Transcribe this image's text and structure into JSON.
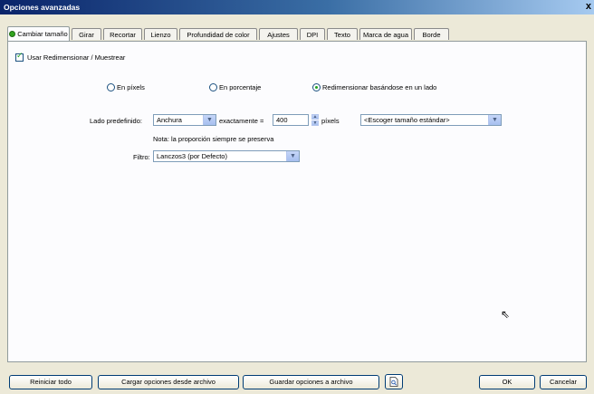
{
  "window": {
    "title": "Opciones avanzadas",
    "close_label": "x"
  },
  "tabs": [
    {
      "label": "Cambiar tamaño",
      "active": true
    },
    {
      "label": "Girar"
    },
    {
      "label": "Recortar"
    },
    {
      "label": "Lienzo"
    },
    {
      "label": "Profundidad de color"
    },
    {
      "label": "Ajustes"
    },
    {
      "label": "DPI"
    },
    {
      "label": "Texto"
    },
    {
      "label": "Marca de agua"
    },
    {
      "label": "Borde"
    }
  ],
  "resize": {
    "use_resample_label": "Usar Redimensionar / Muestrear",
    "use_resample_checked": true,
    "radios": [
      {
        "label": "En píxels",
        "selected": false
      },
      {
        "label": "En porcentaje",
        "selected": false
      },
      {
        "label": "Redimensionar basándose en un lado",
        "selected": true
      }
    ],
    "side_label": "Lado predefinido:",
    "side_value": "Anchura",
    "exact_label": "exactamente =",
    "exact_value": "400",
    "pixels_label": "píxels",
    "standard_size_value": "<Escoger tamaño estándar>",
    "note": "Nota: la proporción siempre se preserva",
    "filter_label": "Filtro:",
    "filter_value": "Lanczos3 (por Defecto)"
  },
  "footer": {
    "reset_all": "Reiniciar todo",
    "load_options": "Cargar opciones desde archivo",
    "save_options": "Guardar opciones a archivo",
    "ok": "OK",
    "cancel": "Cancelar"
  },
  "colors": {
    "accent": "#0a246a",
    "check": "#21a121"
  },
  "icons": {
    "tab_icon": "green-dot-icon",
    "preview": "document-preview-icon",
    "dropdown": "chevron-down-icon"
  }
}
